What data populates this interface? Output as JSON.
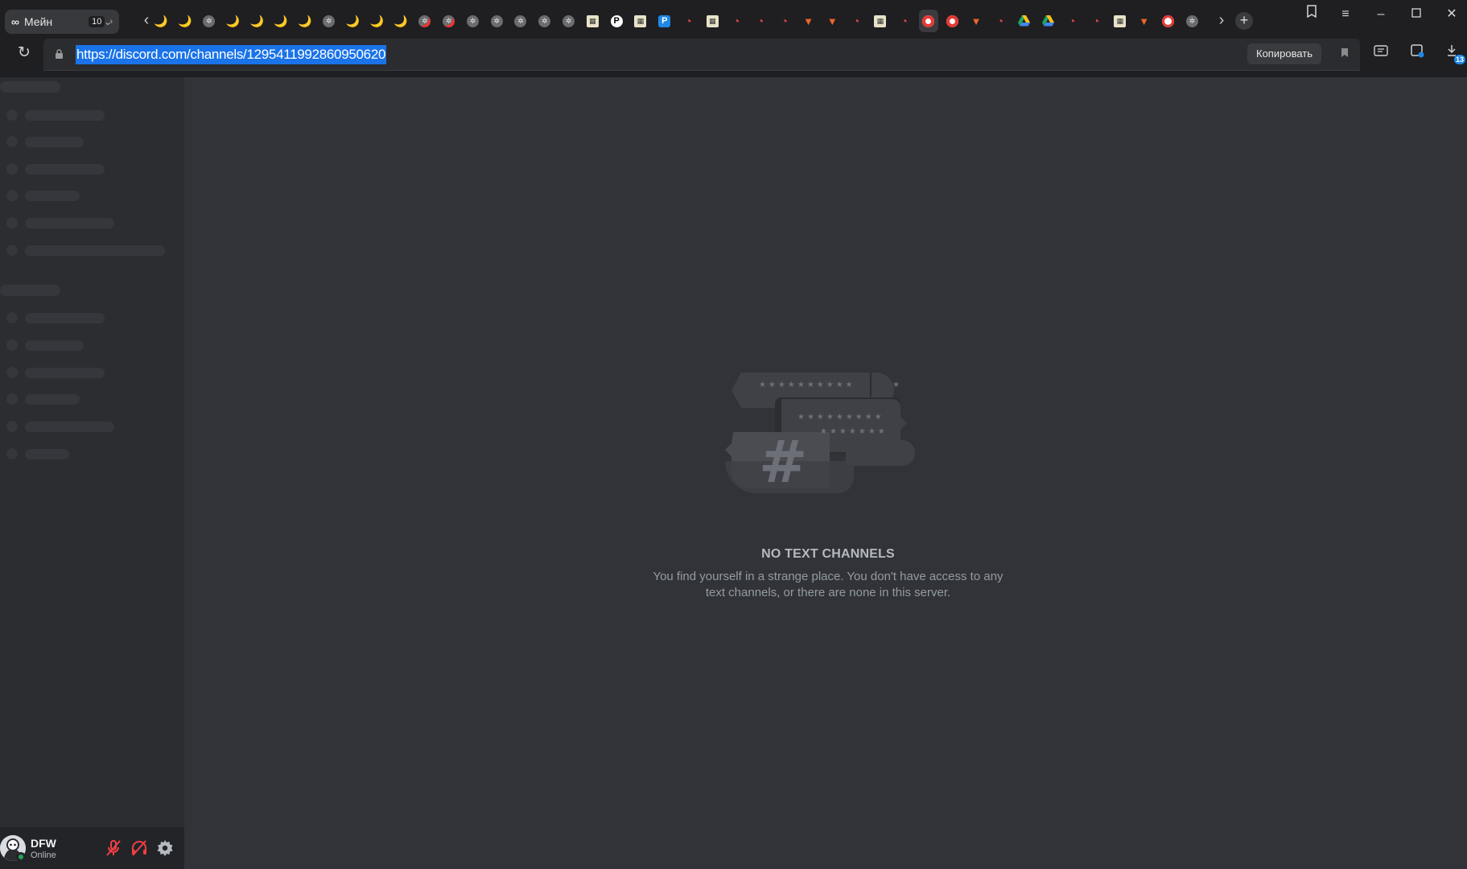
{
  "browser": {
    "workspace": {
      "icon": "∞",
      "name": "Мейн",
      "count": "10"
    },
    "address": {
      "url": "https://discord.com/channels/1295411992860950620",
      "copy_label": "Копировать"
    },
    "extension_badge": "13",
    "tabs": [
      {
        "icon": "banana",
        "glyph": "🌙"
      },
      {
        "icon": "banana",
        "glyph": "🌙"
      },
      {
        "icon": "badge",
        "glyph": "✲"
      },
      {
        "icon": "banana",
        "glyph": "🌙"
      },
      {
        "icon": "banana",
        "glyph": "🌙"
      },
      {
        "icon": "banana",
        "glyph": "🌙"
      },
      {
        "icon": "banana",
        "glyph": "🌙"
      },
      {
        "icon": "badge",
        "glyph": "✲"
      },
      {
        "icon": "banana",
        "glyph": "🌙"
      },
      {
        "icon": "banana",
        "glyph": "🌙"
      },
      {
        "icon": "banana",
        "glyph": "🌙"
      },
      {
        "icon": "badge-red",
        "glyph": "✲"
      },
      {
        "icon": "badge-red",
        "glyph": "✲"
      },
      {
        "icon": "badge",
        "glyph": "✲"
      },
      {
        "icon": "badge",
        "glyph": "✲"
      },
      {
        "icon": "badge",
        "glyph": "✲"
      },
      {
        "icon": "badge",
        "glyph": "✲"
      },
      {
        "icon": "badge",
        "glyph": "✲"
      },
      {
        "icon": "pic",
        "glyph": "▦"
      },
      {
        "icon": "notion",
        "glyph": "P"
      },
      {
        "icon": "pic",
        "glyph": "▦"
      },
      {
        "icon": "p-blue",
        "glyph": "P"
      },
      {
        "icon": "red-d",
        "glyph": "◔"
      },
      {
        "icon": "pic",
        "glyph": "▦"
      },
      {
        "icon": "red-d",
        "glyph": "◔"
      },
      {
        "icon": "red-d",
        "glyph": "◔"
      },
      {
        "icon": "red-d",
        "glyph": "◔"
      },
      {
        "icon": "fox",
        "glyph": "▼"
      },
      {
        "icon": "fox",
        "glyph": "▼"
      },
      {
        "icon": "red-d",
        "glyph": "◔"
      },
      {
        "icon": "pic",
        "glyph": "▦"
      },
      {
        "icon": "red-d",
        "glyph": "◔"
      },
      {
        "icon": "circ-r",
        "glyph": ""
      },
      {
        "icon": "circ-r",
        "glyph": ""
      },
      {
        "icon": "fox",
        "glyph": "▼"
      },
      {
        "icon": "red-d",
        "glyph": "◔"
      },
      {
        "icon": "gdrive",
        "glyph": ""
      },
      {
        "icon": "gdrive",
        "glyph": ""
      },
      {
        "icon": "red-d",
        "glyph": "◔"
      },
      {
        "icon": "red-d",
        "glyph": "◔"
      },
      {
        "icon": "pic",
        "glyph": "▦"
      },
      {
        "icon": "fox",
        "glyph": "▼"
      },
      {
        "icon": "shield",
        "glyph": ""
      },
      {
        "icon": "badge",
        "glyph": "✲"
      }
    ],
    "active_tab_index": 32,
    "colors": {
      "url_highlight": "#1a73e8",
      "accent_online": "#23a55a"
    }
  },
  "discord": {
    "empty_state": {
      "title": "NO TEXT CHANNELS",
      "line1": "You find yourself in a strange place. You don't have access to any",
      "line2": "text channels, or there are none in this server."
    },
    "user": {
      "name": "DFW",
      "status": "Online"
    }
  }
}
